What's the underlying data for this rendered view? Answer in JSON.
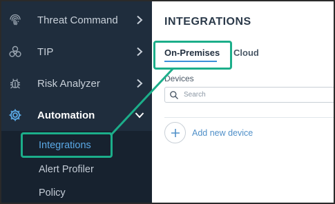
{
  "sidebar": {
    "items": [
      {
        "label": "Threat Command",
        "icon": "fingerprint-icon"
      },
      {
        "label": "TIP",
        "icon": "biohazard-icon"
      },
      {
        "label": "Risk Analyzer",
        "icon": "bug-icon"
      },
      {
        "label": "Automation",
        "icon": "automation-gear-icon",
        "expanded": true
      }
    ],
    "sub_items": [
      {
        "label": "Integrations",
        "active": true
      },
      {
        "label": "Alert Profiler"
      },
      {
        "label": "Policy"
      }
    ]
  },
  "main": {
    "title": "INTEGRATIONS",
    "tabs": [
      {
        "label": "On-Premises",
        "active": true
      },
      {
        "label": "Cloud"
      }
    ],
    "devices_label": "Devices",
    "search": {
      "placeholder": "Search",
      "icon": "search-icon"
    },
    "add_device_label": "Add new device"
  },
  "colors": {
    "sidebar_bg": "#1f2d3d",
    "submenu_bg": "#17222f",
    "active_link": "#5aa9e6",
    "tab_underline": "#3b8fd9",
    "callout": "#1cae8a"
  }
}
